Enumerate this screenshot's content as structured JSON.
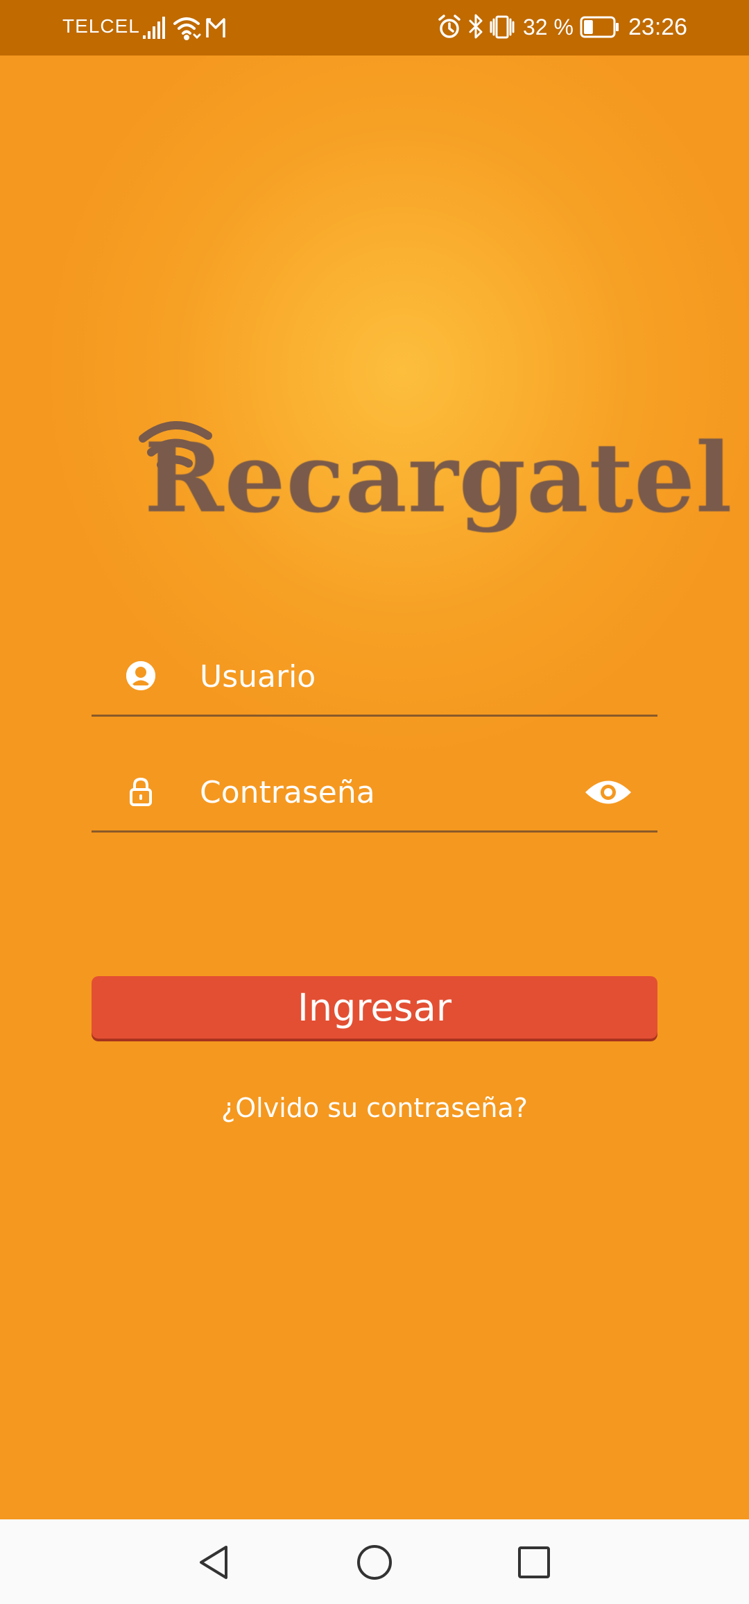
{
  "status_bar": {
    "carrier": "TELCEL",
    "battery_percent": "32 %",
    "battery_level": 0.32,
    "time": "23:26",
    "left_icons": [
      "signal-icon",
      "wifi-icon",
      "gmail-icon"
    ],
    "right_icons": [
      "alarm-icon",
      "bluetooth-icon",
      "vibrate-icon",
      "battery-icon"
    ]
  },
  "logo": {
    "text": "Recargatel",
    "color": "#7A5A4A"
  },
  "form": {
    "username_placeholder": "Usuario",
    "username_value": "",
    "password_placeholder": "Contraseña",
    "password_value": "",
    "user_icon": "user-circle-icon",
    "lock_icon": "lock-icon",
    "eye_icon": "eye-icon"
  },
  "login_button": {
    "label": "Ingresar",
    "color": "#E34F33"
  },
  "forgot_password": {
    "label": "¿Olvido su contraseña?"
  },
  "nav_bar": {
    "buttons": [
      "back-icon",
      "home-icon",
      "recents-icon"
    ]
  },
  "colors": {
    "background": "#F5981F",
    "glow": "#FDBE3D",
    "status_bar": "#C06A00",
    "text": "#FFFFFF"
  }
}
